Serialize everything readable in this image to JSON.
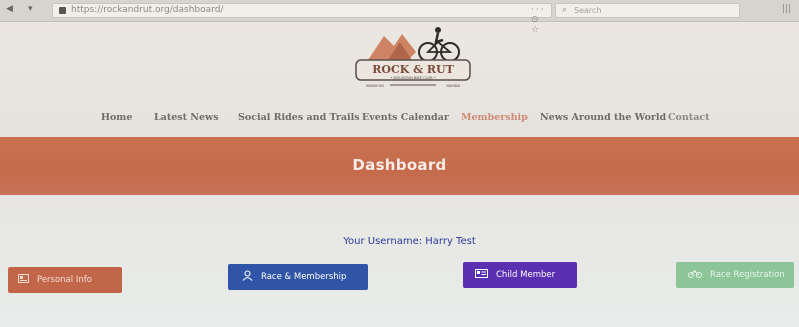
{
  "browser": {
    "url": "https://rockandrut.org/dashboard/",
    "page_actions": "··· ⊙ ☆",
    "search_placeholder": "Search"
  },
  "logo": {
    "line1": "ROCK & RUT",
    "line2": "• MOUNTAIN BIKE CLUB •",
    "left_text": "WINDHOEK",
    "right_text": "NAMIBIA"
  },
  "nav": {
    "items": [
      {
        "label": "Home"
      },
      {
        "label": "Latest News"
      },
      {
        "label": "Social Rides and Trails"
      },
      {
        "label": "Events Calendar"
      },
      {
        "label": "Membership"
      },
      {
        "label": "News Around the World"
      },
      {
        "label": "Contact"
      }
    ],
    "active": "Membership"
  },
  "banner": {
    "title": "Dashboard"
  },
  "user": {
    "username_line": "Your Username: Harry Test"
  },
  "buttons": {
    "personal_info": "Personal Info",
    "race_membership": "Race & Membership",
    "child_member": "Child Member",
    "race_registration": "Race Registration"
  },
  "colors": {
    "banner": "#c56b4c",
    "personal": "#c2664a",
    "race": "#3155a6",
    "child": "#5a2fb0",
    "racereg": "#8cc597",
    "active_nav": "#d08a78",
    "username": "#2a3a9a"
  },
  "icons": {
    "personal": "id-card-icon",
    "race": "user-icon",
    "child": "id-card-icon",
    "racereg": "bicycle-icon"
  }
}
